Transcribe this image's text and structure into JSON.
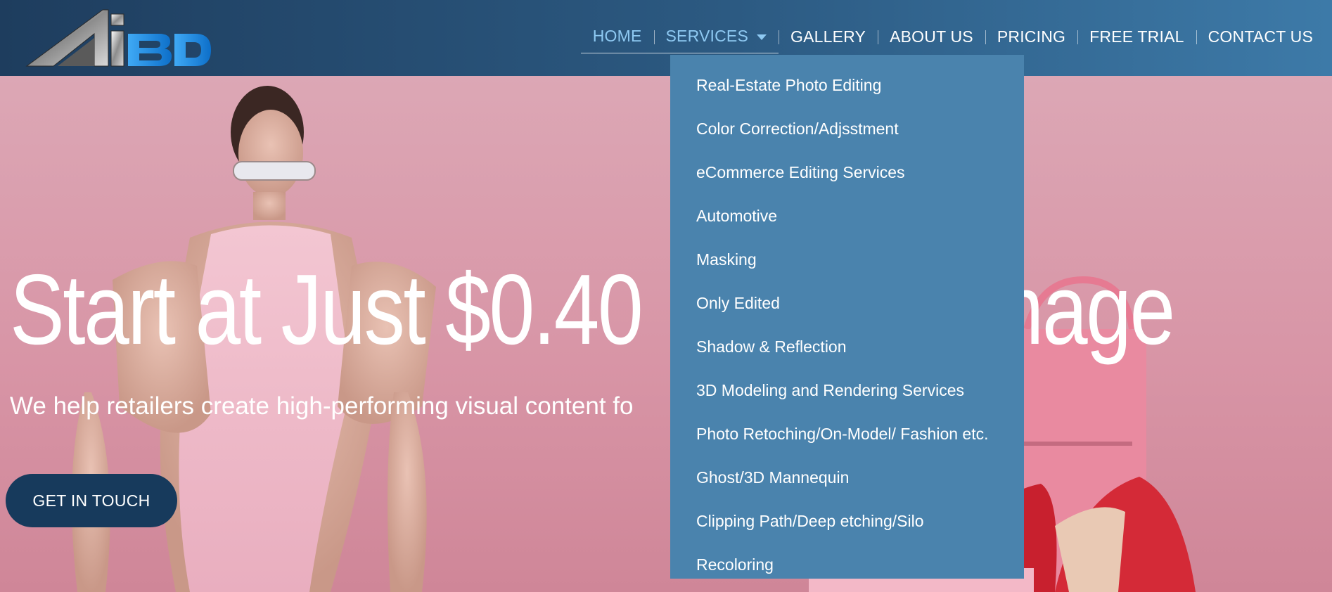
{
  "header": {
    "logo_alt": "AiBD logo",
    "nav": [
      {
        "label": "HOME",
        "state": "active"
      },
      {
        "label": "SERVICES",
        "state": "open"
      },
      {
        "label": "GALLERY"
      },
      {
        "label": "ABOUT US"
      },
      {
        "label": "PRICING"
      },
      {
        "label": "FREE TRIAL"
      },
      {
        "label": "CONTACT US"
      }
    ],
    "accent_color": "#8ec9f2"
  },
  "services_menu": {
    "items": [
      "Real-Estate Photo Editing",
      "Color Correction/Adjsstment",
      "eCommerce Editing Services",
      "Automotive",
      "Masking",
      "Only Edited",
      "Shadow & Reflection",
      "3D Modeling and Rendering Services",
      "Photo Retoching/On-Model/ Fashion etc.",
      "Ghost/3D Mannequin",
      "Clipping Path/Deep etching/Silo",
      "Recoloring"
    ]
  },
  "hero": {
    "title_left": "Start at Just $0.40",
    "title_right": "Image",
    "subtitle": "We help retailers create high-performing visual content fo",
    "cta_label": "GET IN TOUCH",
    "cta_color": "#173a5c",
    "background_color": "#d9a3b1"
  }
}
